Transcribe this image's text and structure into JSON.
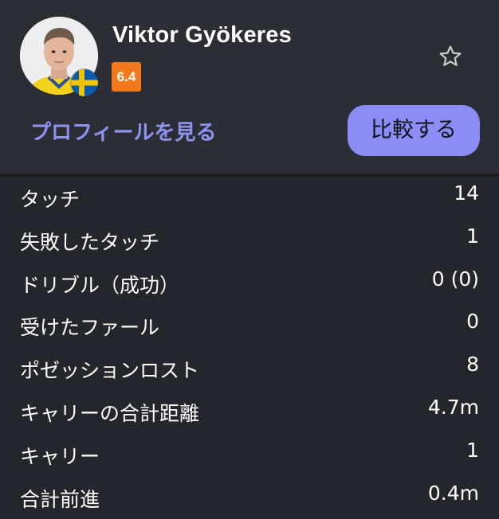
{
  "player": {
    "name": "Viktor Gyökeres",
    "rating": "6.4",
    "flag_colors": {
      "blue": "#0a5ca8",
      "yellow": "#f5c400"
    }
  },
  "actions": {
    "profile_label": "プロフィールを見る",
    "compare_label": "比較する"
  },
  "colors": {
    "background": "#23262c",
    "header": "#2b2e35",
    "accent": "#8b8cf6",
    "link": "#8e93f4",
    "rating_badge": "#f07a1a"
  },
  "icons": {
    "favorite": "star-outline-icon"
  },
  "stats": [
    {
      "label": "タッチ",
      "value": "14"
    },
    {
      "label": "失敗したタッチ",
      "value": "1"
    },
    {
      "label": "ドリブル（成功）",
      "value": "0 (0)"
    },
    {
      "label": "受けたファール",
      "value": "0"
    },
    {
      "label": "ポゼッションロスト",
      "value": "8"
    },
    {
      "label": "キャリーの合計距離",
      "value": "4.7m"
    },
    {
      "label": "キャリー",
      "value": "1"
    },
    {
      "label": "合計前進",
      "value": "0.4m"
    }
  ]
}
